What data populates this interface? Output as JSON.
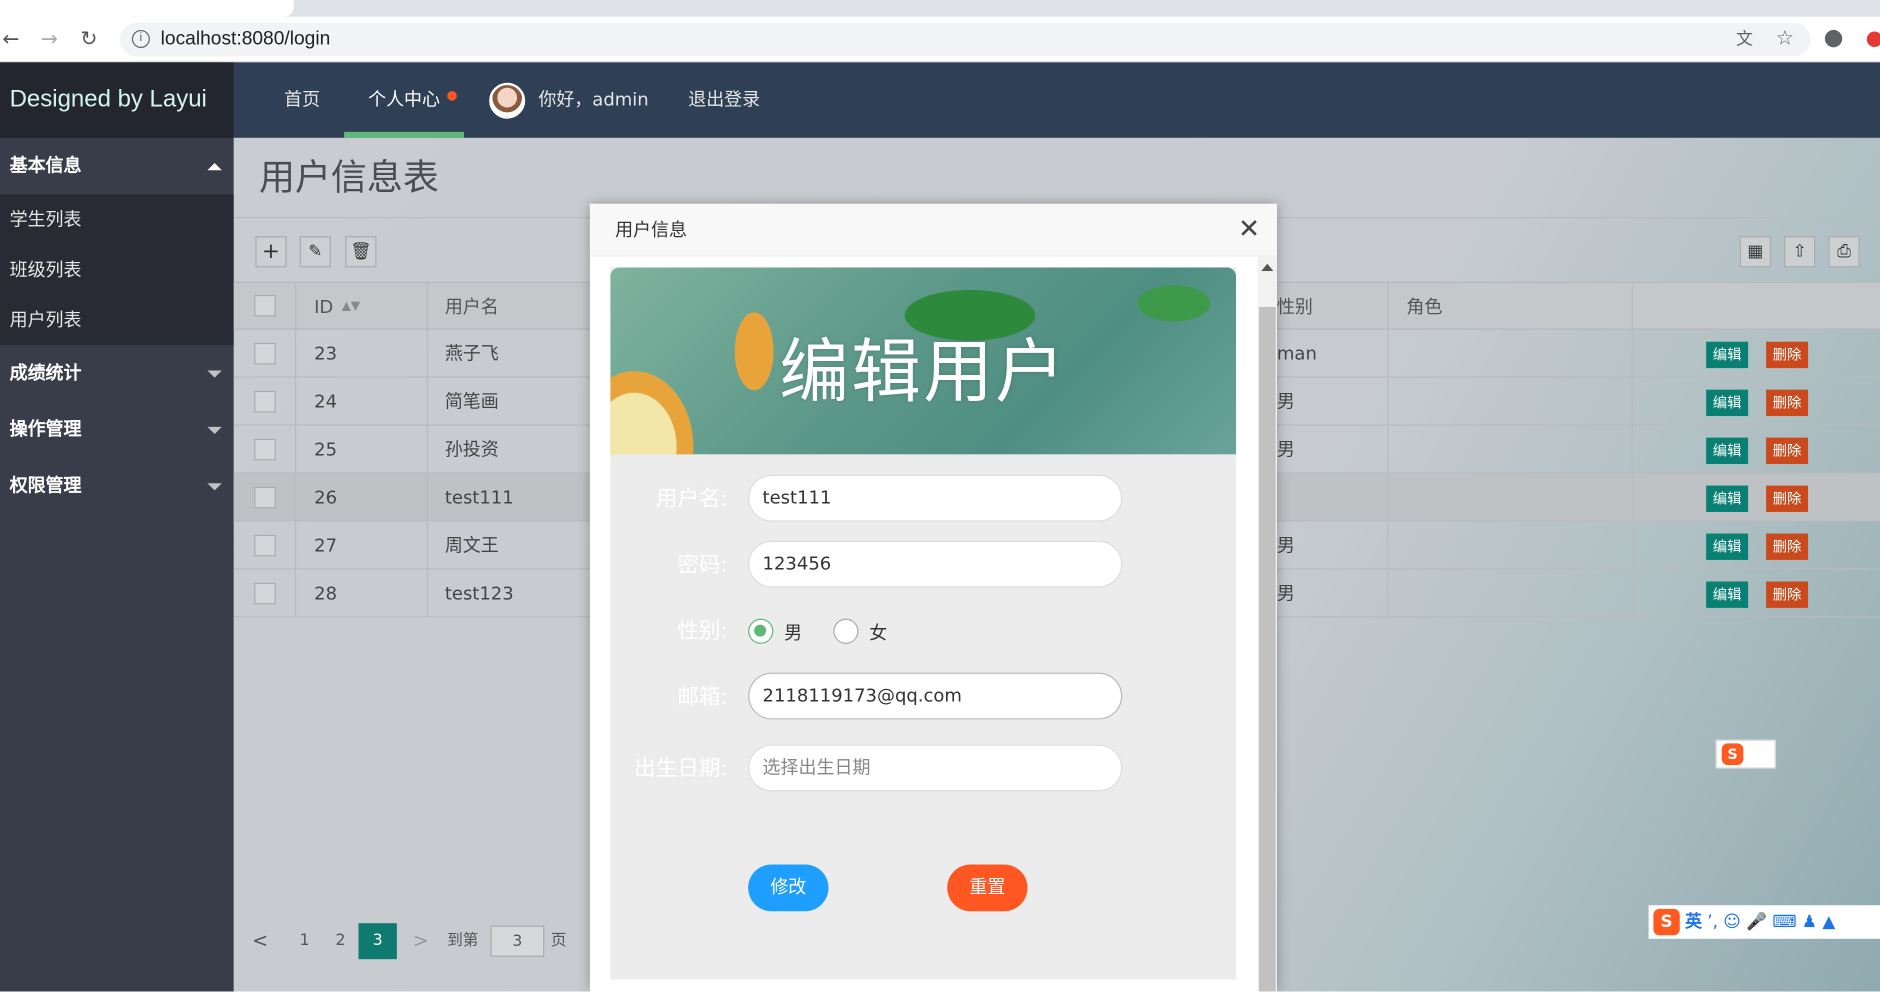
{
  "browser": {
    "url": "localhost:8080/login",
    "back_icon": "arrow-left-icon",
    "forward_icon": "arrow-right-icon",
    "reload_icon": "reload-icon"
  },
  "sidebar": {
    "logo": "Designed by Layui",
    "groups": [
      {
        "label": "基本信息",
        "expanded": true,
        "items": [
          "学生列表",
          "班级列表",
          "用户列表"
        ]
      },
      {
        "label": "成绩统计",
        "expanded": false
      },
      {
        "label": "操作管理",
        "expanded": false
      },
      {
        "label": "权限管理",
        "expanded": false
      }
    ]
  },
  "topnav": {
    "home": "首页",
    "personal": "个人中心",
    "greeting": "你好，admin",
    "logout": "退出登录"
  },
  "page": {
    "title": "用户信息表"
  },
  "table": {
    "columns": [
      "ID",
      "用户名",
      "性别",
      "角色"
    ],
    "rows": [
      {
        "id": "23",
        "username": "燕子飞",
        "gender": "man",
        "role": ""
      },
      {
        "id": "24",
        "username": "简笔画",
        "gender": "男",
        "role": ""
      },
      {
        "id": "25",
        "username": "孙投资",
        "gender": "男",
        "role": ""
      },
      {
        "id": "26",
        "username": "test111",
        "gender": "",
        "role": ""
      },
      {
        "id": "27",
        "username": "周文王",
        "gender": "男",
        "role": ""
      },
      {
        "id": "28",
        "username": "test123",
        "gender": "男",
        "role": ""
      }
    ],
    "edit_label": "编辑",
    "delete_label": "删除"
  },
  "pager": {
    "prev": "<",
    "pages": [
      "1",
      "2",
      "3"
    ],
    "current": "3",
    "next": ">",
    "goto_label": "到第",
    "goto_value": "3",
    "page_suffix": "页"
  },
  "modal": {
    "title": "用户信息",
    "banner_title": "编辑用户",
    "username_label": "用户名:",
    "username_value": "test111",
    "password_label": "密码:",
    "password_value": "123456",
    "gender_label": "性别:",
    "gender_male": "男",
    "gender_female": "女",
    "email_label": "邮箱:",
    "email_value": "2118119173@qq.com",
    "birth_label": "出生日期:",
    "birth_placeholder": "选择出生日期",
    "submit_label": "修改",
    "reset_label": "重置"
  },
  "ime": {
    "lang": "英"
  },
  "colors": {
    "sidebar": "#393d49",
    "topbar": "#2f4056",
    "accent_green": "#5fb878",
    "edit_button": "#0a7f73",
    "delete_button": "#ca4a1d",
    "submit_button": "#1e9fff",
    "reset_button": "#ff5722"
  }
}
